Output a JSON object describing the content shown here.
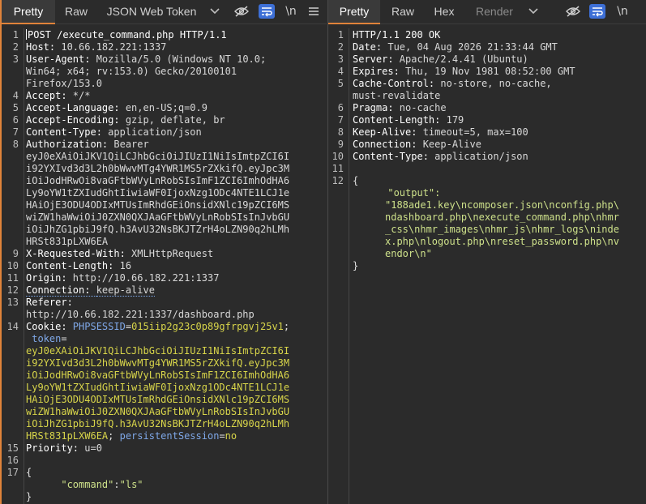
{
  "request_pane": {
    "tabs": [
      "Pretty",
      "Raw",
      "JSON Web Token"
    ],
    "active_tab": "Pretty",
    "newline_toggle": "\\n",
    "colors": {
      "accent": "#e0833a",
      "key": "#ffffff",
      "cookie_name": "#7fa8e8",
      "cookie_value": "#d8d54a"
    },
    "line_numbers": [
      "1",
      "2",
      "3",
      "4",
      "5",
      "6",
      "7",
      "8",
      "9",
      "10",
      "11",
      "12",
      "13",
      "14",
      "15",
      "16",
      "17"
    ],
    "lines": [
      {
        "key": "POST /execute_command.php HTTP/1.1"
      },
      {
        "key": "Host: ",
        "value": "10.66.182.221:1337"
      },
      {
        "key": "User-Agent: ",
        "value": "Mozilla/5.0 (Windows NT 10.0;",
        "wrap": [
          "Win64; x64; rv:153.0) Gecko/20100101",
          "Firefox/153.0"
        ]
      },
      {
        "key": "Accept: ",
        "value": "*/*"
      },
      {
        "key": "Accept-Language: ",
        "value": "en,en-US;q=0.9"
      },
      {
        "key": "Accept-Encoding: ",
        "value": "gzip, deflate, br"
      },
      {
        "key": "Content-Type: ",
        "value": "application/json"
      },
      {
        "key": "Authorization: ",
        "value": "Bearer",
        "wrap": [
          "eyJ0eXAiOiJKV1QiLCJhbGciOiJIUzI1NiIsImtpZCI6I",
          "i92YXIvd3d3L2h0bWwvMTg4YWR1MS5rZXkifQ.eyJpc3M",
          "iOiJodHRwOi8vaGFtbWVyLnRobSIsImF1ZCI6ImhOdHA6",
          "Ly9oYW1tZXIudGhtIiwiaWF0IjoxNzg1ODc4NTE1LCJ1e",
          "HAiOjE3ODU4ODIxMTUsImRhdGEiOnsidXNlc19pZCI6MS",
          "wiZW1haWwiOiJ0ZXN0QXJAaGFtbWVyLnRobSIsInJvbGU",
          "iOiJhZG1pbiJ9fQ.h3AvU32NsBKJTZrH4oLZN90q2hLMh",
          "HRSt831pLXW6EA"
        ]
      },
      {
        "key": "X-Requested-With: ",
        "value": "XMLHttpRequest"
      },
      {
        "key": "Content-Length: ",
        "value": "16"
      },
      {
        "key": "Origin: ",
        "value": "http://10.66.182.221:1337"
      },
      {
        "key": "Connection: ",
        "value": "keep-alive"
      },
      {
        "key": "Referer:",
        "value": "",
        "wrap": [
          "http://10.66.182.221:1337/dashboard.php"
        ]
      },
      {
        "key": "Cookie: ",
        "cookie_name": "PHPSESSID",
        "cookie_value": "015iip2g23c0p89gfrpgvj25v1",
        "cookie2_name": " token",
        "wrap": [
          "eyJ0eXAiOiJKV1QiLCJhbGciOiJIUzI1NiIsImtpZCI6I",
          "i92YXIvd3d3L2h0bWwvMTg4YWR1MS5rZXkifQ.eyJpc3M",
          "iOiJodHRwOi8vaGFtbWVyLnRobSIsImF1ZCI6ImhOdHA6",
          "Ly9oYW1tZXIudGhtIiwiaWF0IjoxNzg1ODc4NTE1LCJ1e",
          "HAiOjE3ODU4ODIxMTUsImRhdGEiOnsidXNlc19pZCI6MS",
          "wiZW1haWwiOiJ0ZXN0QXJAaGFtbWVyLnRobSIsInJvbGU",
          "iOiJhZG1pbiJ9fQ.h3AvU32NsBKJTZrH4oLZN90q2hLMh",
          "HRSt831pLXW6EA"
        ],
        "cookie3_name": "persistentSession",
        "cookie3_value": "no"
      },
      {
        "key": "Priority: ",
        "value": "u=0"
      },
      {
        "key": ""
      },
      {
        "key": "{",
        "body": [
          "\"command\":\"ls\"",
          "}"
        ]
      }
    ],
    "body_key": "\"command\"",
    "body_value": "\"ls\""
  },
  "response_pane": {
    "tabs": [
      "Pretty",
      "Raw",
      "Hex",
      "Render"
    ],
    "active_tab": "Pretty",
    "newline_toggle": "\\n",
    "line_numbers": [
      "1",
      "2",
      "3",
      "4",
      "5",
      "6",
      "7",
      "8",
      "9",
      "10",
      "11",
      "12"
    ],
    "lines": [
      {
        "key": "HTTP/1.1 200 OK"
      },
      {
        "key": "Date: ",
        "value": "Tue, 04 Aug 2026 21:33:44 GMT"
      },
      {
        "key": "Server: ",
        "value": "Apache/2.4.41 (Ubuntu)"
      },
      {
        "key": "Expires: ",
        "value": "Thu, 19 Nov 1981 08:52:00 GMT"
      },
      {
        "key": "Cache-Control: ",
        "value": "no-store, no-cache,",
        "wrap": [
          "must-revalidate"
        ]
      },
      {
        "key": "Pragma: ",
        "value": "no-cache"
      },
      {
        "key": "Content-Length: ",
        "value": "179"
      },
      {
        "key": "Keep-Alive: ",
        "value": "timeout=5, max=100"
      },
      {
        "key": "Connection: ",
        "value": "Keep-Alive"
      },
      {
        "key": "Content-Type: ",
        "value": "application/json"
      },
      {
        "key": ""
      },
      {
        "key": "{"
      }
    ],
    "json_key": "\"output\":",
    "json_value_lines": [
      "\"188ade1.key\\ncomposer.json\\nconfig.php\\",
      "ndashboard.php\\nexecute_command.php\\nhmr",
      "_css\\nhmr_images\\nhmr_js\\nhmr_logs\\ninde",
      "x.php\\nlogout.php\\nreset_password.php\\nv",
      "endor\\n\""
    ],
    "json_close": "}"
  }
}
